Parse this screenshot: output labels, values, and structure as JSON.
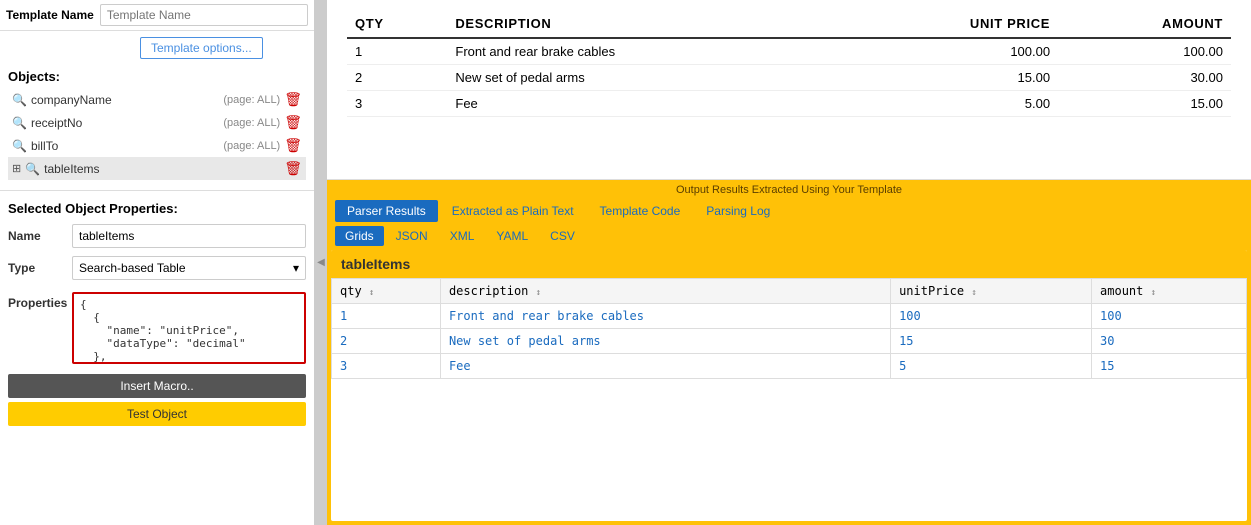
{
  "leftPanel": {
    "templateNameLabel": "Template Name",
    "templateNamePlaceholder": "Template Name",
    "templateOptionsBtn": "Template options...",
    "objectsTitle": "Objects:",
    "objects": [
      {
        "name": "companyName",
        "page": "(page: ALL)",
        "icon": "search",
        "selected": false
      },
      {
        "name": "receiptNo",
        "page": "(page: ALL)",
        "icon": "search",
        "selected": false
      },
      {
        "name": "billTo",
        "page": "(page: ALL)",
        "icon": "search",
        "selected": false
      },
      {
        "name": "tableItems",
        "page": "",
        "icon": "table",
        "selected": true
      }
    ],
    "selectedPropsTitle": "Selected Object Properties:",
    "nameLabel": "Name",
    "nameValue": "tableItems",
    "typeLabel": "Type",
    "typeValue": "Search-based Table",
    "propertiesLabel": "Properties",
    "propertiesValue": "{\n  {\n    \"name\": \"unitPrice\",\n    \"dataType\": \"decimal\"\n  },\n}",
    "insertMacroBtn": "Insert Macro..",
    "testObjectBtn": "Test Object"
  },
  "docPreview": {
    "columns": [
      {
        "label": "QTY",
        "align": "left"
      },
      {
        "label": "DESCRIPTION",
        "align": "left"
      },
      {
        "label": "UNIT PRICE",
        "align": "right"
      },
      {
        "label": "AMOUNT",
        "align": "right"
      }
    ],
    "rows": [
      {
        "qty": "1",
        "description": "Front and rear brake cables",
        "unitPrice": "100.00",
        "amount": "100.00"
      },
      {
        "qty": "2",
        "description": "New set of pedal arms",
        "unitPrice": "15.00",
        "amount": "30.00"
      },
      {
        "qty": "3",
        "description": "Fee",
        "unitPrice": "5.00",
        "amount": "15.00"
      }
    ]
  },
  "outputPanel": {
    "headerText": "Output Results Extracted Using Your Template",
    "tabs": [
      {
        "label": "Parser Results",
        "active": true
      },
      {
        "label": "Extracted as Plain Text",
        "active": false
      },
      {
        "label": "Template Code",
        "active": false
      },
      {
        "label": "Parsing Log",
        "active": false
      }
    ],
    "subTabs": [
      {
        "label": "Grids",
        "active": true
      },
      {
        "label": "JSON",
        "active": false
      },
      {
        "label": "XML",
        "active": false
      },
      {
        "label": "YAML",
        "active": false
      },
      {
        "label": "CSV",
        "active": false
      }
    ],
    "gridTitle": "tableItems",
    "gridColumns": [
      {
        "label": "qty"
      },
      {
        "label": "description"
      },
      {
        "label": "unitPrice"
      },
      {
        "label": "amount"
      }
    ],
    "gridRows": [
      {
        "qty": "1",
        "description": "Front and rear brake cables",
        "unitPrice": "100",
        "amount": "100"
      },
      {
        "qty": "2",
        "description": "New set of pedal arms",
        "unitPrice": "15",
        "amount": "30"
      },
      {
        "qty": "3",
        "description": "Fee",
        "unitPrice": "5",
        "amount": "15"
      }
    ]
  }
}
